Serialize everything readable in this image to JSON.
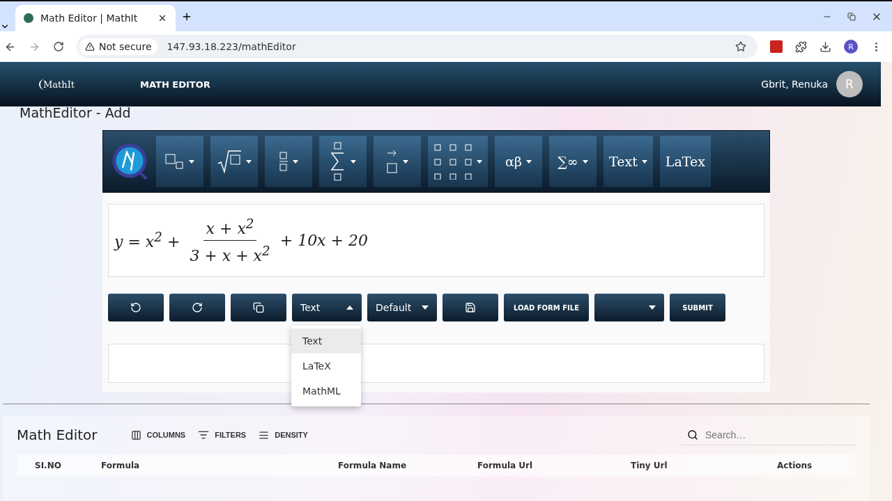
{
  "browser": {
    "tab_title": "Math Editor | MathIt",
    "security": "Not secure",
    "url": "147.93.18.223/mathEditor",
    "profile_initial": "R"
  },
  "app_header": {
    "logo": "MathIt",
    "nav": "MATH EDITOR",
    "user": "Gbrit,  Renuka",
    "avatar_initial": "R"
  },
  "page_title": "MathEditor - Add",
  "palette": [
    {
      "kind": "subscript"
    },
    {
      "kind": "root"
    },
    {
      "kind": "fraction"
    },
    {
      "kind": "sum"
    },
    {
      "kind": "arrow"
    },
    {
      "kind": "matrix"
    },
    {
      "kind": "label",
      "label": "αβ",
      "caret": true
    },
    {
      "kind": "label",
      "label": "∑∞",
      "caret": true
    },
    {
      "kind": "label",
      "label": "Text",
      "caret": true
    },
    {
      "kind": "label",
      "label": "LaTex",
      "caret": false
    }
  ],
  "formula": {
    "lhs": "y = x$^{2}$ +",
    "numerator": "x + x$^{2}$",
    "denominator": "3 + x + x$^{2}$",
    "tail": "+ 10x + 20"
  },
  "actions": [
    {
      "kind": "undo"
    },
    {
      "kind": "redo"
    },
    {
      "kind": "copy"
    },
    {
      "kind": "select",
      "label": "Text",
      "expanded": true
    },
    {
      "kind": "select",
      "label": "Default",
      "expanded": false
    },
    {
      "kind": "save"
    },
    {
      "kind": "text",
      "label": "LOAD FORM FILE"
    },
    {
      "kind": "select",
      "expanded": false
    },
    {
      "kind": "text",
      "label": "SUBMIT"
    }
  ],
  "format_menu": [
    {
      "label": "Text",
      "selected": true
    },
    {
      "label": "LaTeX",
      "selected": false
    },
    {
      "label": "MathML",
      "selected": false
    }
  ],
  "grid": {
    "title": "Math Editor",
    "tools": [
      {
        "kind": "columns",
        "label": "COLUMNS"
      },
      {
        "kind": "filters",
        "label": "FILTERS"
      },
      {
        "kind": "density",
        "label": "DENSITY"
      }
    ],
    "search_placeholder": "Search…",
    "columns": [
      "SI.NO",
      "Formula",
      "Formula Name",
      "Formula Url",
      "Tiny Url",
      "Actions"
    ]
  }
}
